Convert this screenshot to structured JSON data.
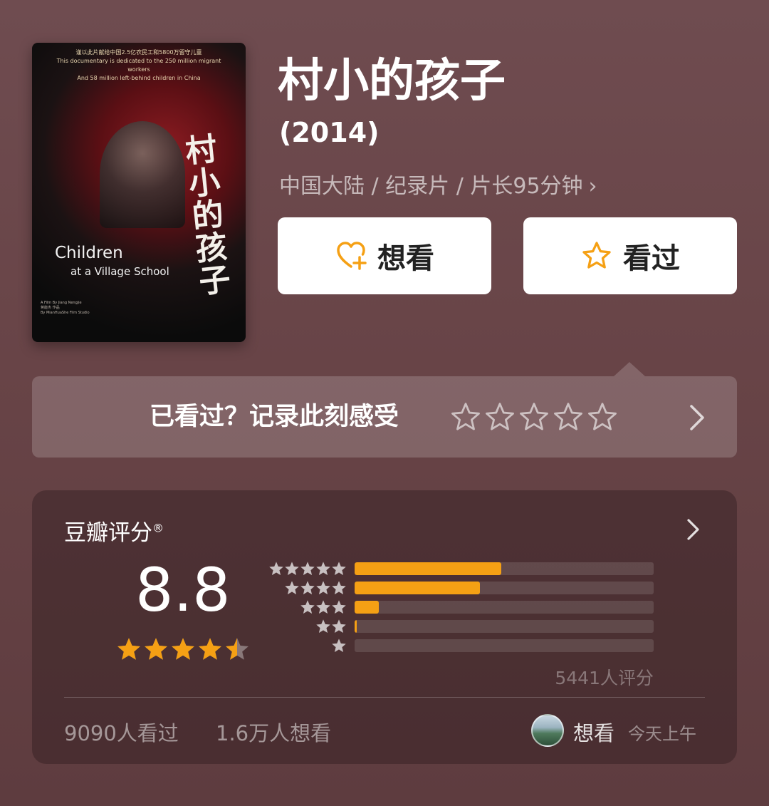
{
  "poster": {
    "dedication": "谨以此片献给中国2.5亿农民工和5800万留守儿童\nThis documentary is dedicated to the 250 million migrant workers\nAnd 58 million left-behind children in China",
    "vertical_title": "村小的孩子",
    "english_title_1": "Children",
    "english_title_2": "at a Village School",
    "credits": "A Film By Jiang Nengjie\n蒋能杰 作品\nBy MianHuaShe Film Studio"
  },
  "movie": {
    "title": "村小的孩子",
    "year": "(2014)",
    "meta": "中国大陆 / 纪录片 / 片长95分钟",
    "meta_chevron": "›"
  },
  "actions": {
    "want_label": "想看",
    "seen_label": "看过"
  },
  "record": {
    "prompt": "已看过？记录此刻感受",
    "star_count": 5
  },
  "rating": {
    "label": "豆瓣评分",
    "registered_mark": "®",
    "score": "8.8",
    "average_stars": 4.5,
    "distribution": [
      {
        "stars": 5,
        "fraction": 0.49
      },
      {
        "stars": 4,
        "fraction": 0.42
      },
      {
        "stars": 3,
        "fraction": 0.08
      },
      {
        "stars": 2,
        "fraction": 0.005
      },
      {
        "stars": 1,
        "fraction": 0.0
      }
    ],
    "count_text": "5441人评分",
    "watched_text": "9090人看过",
    "wanting_text": "1.6万人想看",
    "friend_action": "想看",
    "friend_time": "今天上午"
  },
  "colors": {
    "accent": "#f5a014",
    "button_bg": "#ffffff",
    "page_bg": "#6b474a"
  }
}
